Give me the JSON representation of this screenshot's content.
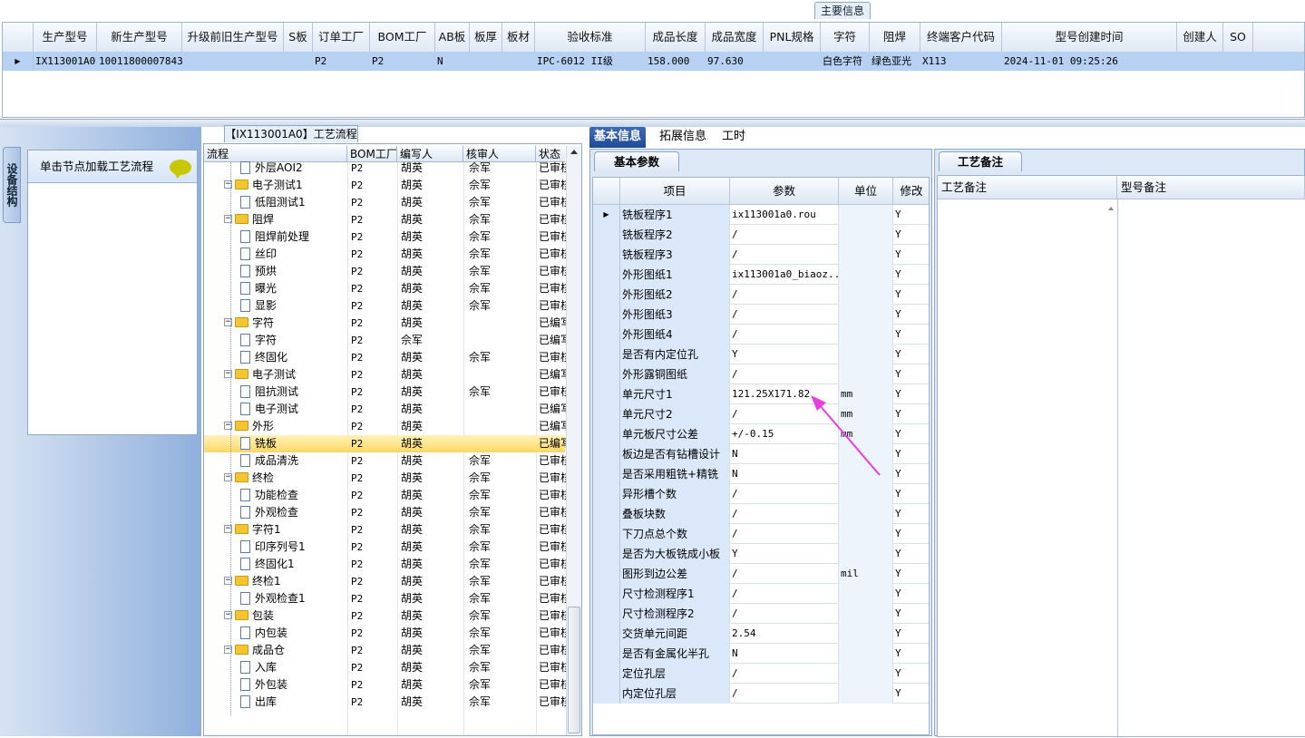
{
  "top": {
    "title": "主要信息",
    "columns": [
      "生产型号",
      "新生产型号",
      "升级前旧生产型号",
      "S板",
      "订单工厂",
      "BOM工厂",
      "AB板",
      "板厚",
      "板材",
      "验收标准",
      "成品长度",
      "成品宽度",
      "PNL规格",
      "字符",
      "阻焊",
      "终端客户代码",
      "型号创建时间",
      "创建人",
      "SO"
    ],
    "row": [
      "IX113001A0",
      "10011800007843",
      "",
      "",
      "P2",
      "P2",
      "N",
      "",
      "",
      "IPC-6012 II级",
      "158.000",
      "97.630",
      "",
      "白色字符",
      "绿色亚光",
      "X113",
      "2024-11-01 09:25:26",
      "",
      ""
    ]
  },
  "left": {
    "vertical_tab": "设备结构",
    "load_text": "单击节点加载工艺流程"
  },
  "tree": {
    "title": "【IX113001A0】工艺流程",
    "headers": [
      "流程",
      "BOM工厂",
      "编写人",
      "核审人",
      "状态"
    ],
    "rows": [
      {
        "level": 1,
        "name": "外层AOI2",
        "bom": "P2",
        "writer": "胡英",
        "reviewer": "佘军",
        "status": "已审核"
      },
      {
        "level": 0,
        "name": "电子测试1",
        "bom": "P2",
        "writer": "胡英",
        "reviewer": "佘军",
        "status": "已审核"
      },
      {
        "level": 1,
        "name": "低阻测试1",
        "bom": "P2",
        "writer": "胡英",
        "reviewer": "佘军",
        "status": "已审核"
      },
      {
        "level": 0,
        "name": "阻焊",
        "bom": "P2",
        "writer": "胡英",
        "reviewer": "佘军",
        "status": "已审核"
      },
      {
        "level": 1,
        "name": "阻焊前处理",
        "bom": "P2",
        "writer": "胡英",
        "reviewer": "佘军",
        "status": "已审核"
      },
      {
        "level": 1,
        "name": "丝印",
        "bom": "P2",
        "writer": "胡英",
        "reviewer": "佘军",
        "status": "已审核"
      },
      {
        "level": 1,
        "name": "预烘",
        "bom": "P2",
        "writer": "胡英",
        "reviewer": "佘军",
        "status": "已审核"
      },
      {
        "level": 1,
        "name": "曝光",
        "bom": "P2",
        "writer": "胡英",
        "reviewer": "佘军",
        "status": "已审核"
      },
      {
        "level": 1,
        "name": "显影",
        "bom": "P2",
        "writer": "胡英",
        "reviewer": "佘军",
        "status": "已审核"
      },
      {
        "level": 0,
        "name": "字符",
        "bom": "P2",
        "writer": "胡英",
        "reviewer": "",
        "status": "已编写"
      },
      {
        "level": 1,
        "name": "字符",
        "bom": "P2",
        "writer": "佘军",
        "reviewer": "",
        "status": "已编写"
      },
      {
        "level": 1,
        "name": "终固化",
        "bom": "P2",
        "writer": "胡英",
        "reviewer": "佘军",
        "status": "已审核"
      },
      {
        "level": 0,
        "name": "电子测试",
        "bom": "P2",
        "writer": "胡英",
        "reviewer": "",
        "status": "已编写"
      },
      {
        "level": 1,
        "name": "阻抗测试",
        "bom": "P2",
        "writer": "胡英",
        "reviewer": "佘军",
        "status": "已审核"
      },
      {
        "level": 1,
        "name": "电子测试",
        "bom": "P2",
        "writer": "胡英",
        "reviewer": "",
        "status": "已编写"
      },
      {
        "level": 0,
        "name": "外形",
        "bom": "P2",
        "writer": "胡英",
        "reviewer": "",
        "status": "已编写"
      },
      {
        "level": 1,
        "name": "铣板",
        "bom": "P2",
        "writer": "胡英",
        "reviewer": "",
        "status": "已编写",
        "selected": true
      },
      {
        "level": 1,
        "name": "成品清洗",
        "bom": "P2",
        "writer": "胡英",
        "reviewer": "佘军",
        "status": "已审核"
      },
      {
        "level": 0,
        "name": "终检",
        "bom": "P2",
        "writer": "胡英",
        "reviewer": "佘军",
        "status": "已审核"
      },
      {
        "level": 1,
        "name": "功能检查",
        "bom": "P2",
        "writer": "胡英",
        "reviewer": "佘军",
        "status": "已审核"
      },
      {
        "level": 1,
        "name": "外观检查",
        "bom": "P2",
        "writer": "胡英",
        "reviewer": "佘军",
        "status": "已审核"
      },
      {
        "level": 0,
        "name": "字符1",
        "bom": "P2",
        "writer": "胡英",
        "reviewer": "佘军",
        "status": "已审核"
      },
      {
        "level": 1,
        "name": "印序列号1",
        "bom": "P2",
        "writer": "胡英",
        "reviewer": "佘军",
        "status": "已审核"
      },
      {
        "level": 1,
        "name": "终固化1",
        "bom": "P2",
        "writer": "胡英",
        "reviewer": "佘军",
        "status": "已审核"
      },
      {
        "level": 0,
        "name": "终检1",
        "bom": "P2",
        "writer": "胡英",
        "reviewer": "佘军",
        "status": "已审核"
      },
      {
        "level": 1,
        "name": "外观检查1",
        "bom": "P2",
        "writer": "胡英",
        "reviewer": "佘军",
        "status": "已审核"
      },
      {
        "level": 0,
        "name": "包装",
        "bom": "P2",
        "writer": "胡英",
        "reviewer": "佘军",
        "status": "已审核"
      },
      {
        "level": 1,
        "name": "内包装",
        "bom": "P2",
        "writer": "胡英",
        "reviewer": "佘军",
        "status": "已审核"
      },
      {
        "level": 0,
        "name": "成品仓",
        "bom": "P2",
        "writer": "胡英",
        "reviewer": "佘军",
        "status": "已审核"
      },
      {
        "level": 1,
        "name": "入库",
        "bom": "P2",
        "writer": "胡英",
        "reviewer": "佘军",
        "status": "已审核"
      },
      {
        "level": 1,
        "name": "外包装",
        "bom": "P2",
        "writer": "胡英",
        "reviewer": "佘军",
        "status": "已审核"
      },
      {
        "level": 1,
        "name": "出库",
        "bom": "P2",
        "writer": "胡英",
        "reviewer": "佘军",
        "status": "已审核"
      }
    ]
  },
  "right": {
    "tabs": [
      "基本信息",
      "拓展信息",
      "工时"
    ],
    "basic_tab": "基本参数",
    "param_headers": [
      "项目",
      "参数",
      "单位",
      "修改"
    ],
    "params": [
      {
        "name": "铣板程序1",
        "value": "ix113001a0.rou",
        "unit": "",
        "mod": "Y"
      },
      {
        "name": "铣板程序2",
        "value": "/",
        "unit": "",
        "mod": "Y"
      },
      {
        "name": "铣板程序3",
        "value": "/",
        "unit": "",
        "mod": "Y"
      },
      {
        "name": "外形图纸1",
        "value": "ix113001a0_biaoz...",
        "unit": "",
        "mod": "Y"
      },
      {
        "name": "外形图纸2",
        "value": "/",
        "unit": "",
        "mod": "Y"
      },
      {
        "name": "外形图纸3",
        "value": "/",
        "unit": "",
        "mod": "Y"
      },
      {
        "name": "外形图纸4",
        "value": "/",
        "unit": "",
        "mod": "Y"
      },
      {
        "name": "是否有内定位孔",
        "value": "Y",
        "unit": "",
        "mod": "Y"
      },
      {
        "name": "外形露铜图纸",
        "value": "/",
        "unit": "",
        "mod": "Y"
      },
      {
        "name": "单元尺寸1",
        "value": "121.25X171.82",
        "unit": "mm",
        "mod": "Y"
      },
      {
        "name": "单元尺寸2",
        "value": "/",
        "unit": "mm",
        "mod": "Y"
      },
      {
        "name": "单元板尺寸公差",
        "value": "+/-0.15",
        "unit": "mm",
        "mod": "Y"
      },
      {
        "name": "板边是否有钻槽设计",
        "value": "N",
        "unit": "",
        "mod": "Y"
      },
      {
        "name": "是否采用粗铣+精铣",
        "value": "N",
        "unit": "",
        "mod": "Y"
      },
      {
        "name": "异形槽个数",
        "value": "/",
        "unit": "",
        "mod": "Y"
      },
      {
        "name": "叠板块数",
        "value": "/",
        "unit": "",
        "mod": "Y"
      },
      {
        "name": "下刀点总个数",
        "value": "/",
        "unit": "",
        "mod": "Y"
      },
      {
        "name": "是否为大板铣成小板",
        "value": "Y",
        "unit": "",
        "mod": "Y"
      },
      {
        "name": "图形到边公差",
        "value": "/",
        "unit": "mil",
        "mod": "Y"
      },
      {
        "name": "尺寸检测程序1",
        "value": "/",
        "unit": "",
        "mod": "Y"
      },
      {
        "name": "尺寸检测程序2",
        "value": "/",
        "unit": "",
        "mod": "Y"
      },
      {
        "name": "交货单元间距",
        "value": "2.54",
        "unit": "",
        "mod": "Y"
      },
      {
        "name": "是否有金属化半孔",
        "value": "N",
        "unit": "",
        "mod": "Y"
      },
      {
        "name": "定位孔层",
        "value": "/",
        "unit": "",
        "mod": "Y"
      },
      {
        "name": "内定位孔层",
        "value": "/",
        "unit": "",
        "mod": "Y"
      }
    ],
    "note_tab": "工艺备注",
    "note_headers": [
      "工艺备注",
      "型号备注"
    ],
    "annotation_color": "#e83ee0"
  }
}
